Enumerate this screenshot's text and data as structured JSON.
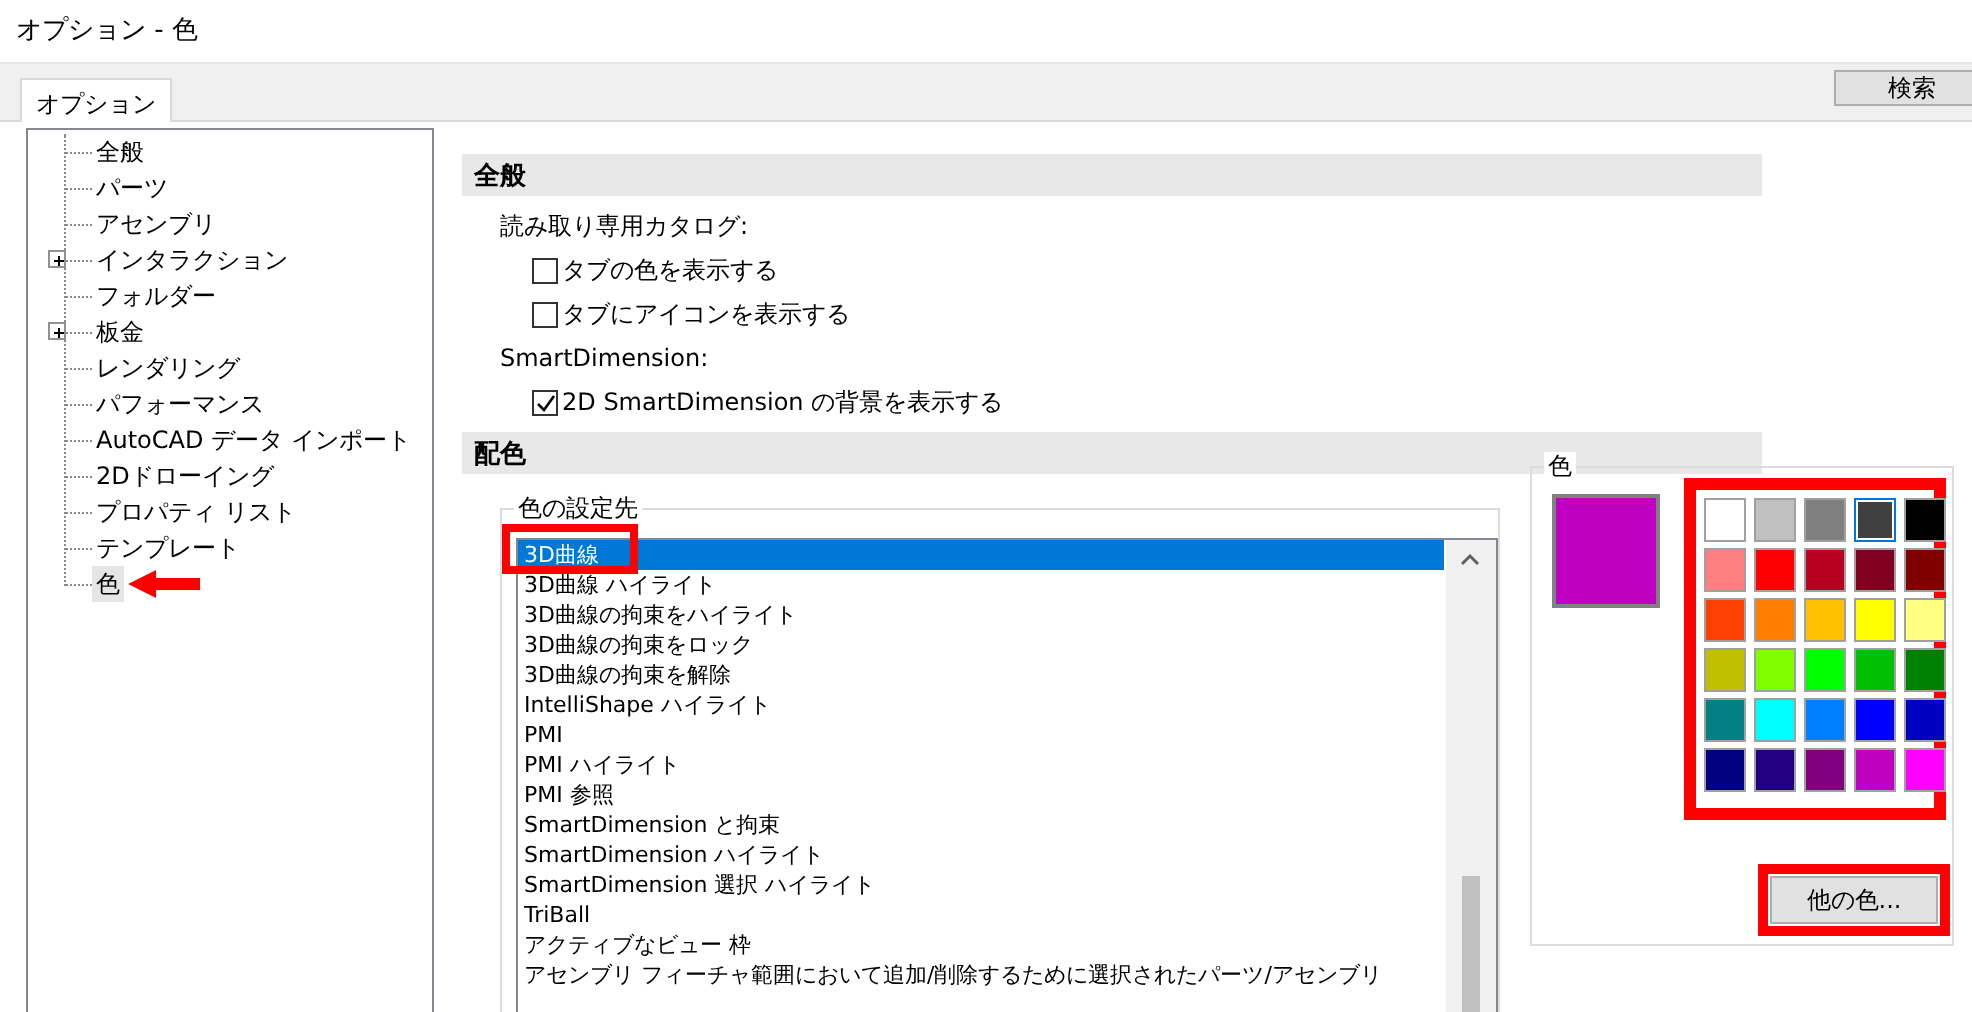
{
  "window": {
    "title": "オプション - 色"
  },
  "tabs": [
    {
      "label": "オプション",
      "selected": true
    }
  ],
  "search_button": {
    "label": "検索"
  },
  "sidebar": {
    "items": [
      {
        "label": "全般",
        "expandable": false,
        "selected": false,
        "arrow": false
      },
      {
        "label": "パーツ",
        "expandable": false,
        "selected": false,
        "arrow": false
      },
      {
        "label": "アセンブリ",
        "expandable": false,
        "selected": false,
        "arrow": false
      },
      {
        "label": "インタラクション",
        "expandable": true,
        "selected": false,
        "arrow": false
      },
      {
        "label": "フォルダー",
        "expandable": false,
        "selected": false,
        "arrow": false
      },
      {
        "label": "板金",
        "expandable": true,
        "selected": false,
        "arrow": false
      },
      {
        "label": "レンダリング",
        "expandable": false,
        "selected": false,
        "arrow": false
      },
      {
        "label": "パフォーマンス",
        "expandable": false,
        "selected": false,
        "arrow": false
      },
      {
        "label": "AutoCAD データ インポート",
        "expandable": false,
        "selected": false,
        "arrow": false
      },
      {
        "label": "2Dドローイング",
        "expandable": false,
        "selected": false,
        "arrow": false
      },
      {
        "label": "プロパティ リスト",
        "expandable": false,
        "selected": false,
        "arrow": false
      },
      {
        "label": "テンプレート",
        "expandable": false,
        "selected": false,
        "arrow": false
      },
      {
        "label": "色",
        "expandable": false,
        "selected": true,
        "arrow": true
      }
    ]
  },
  "general": {
    "title": "全般",
    "groups": [
      {
        "label": "読み取り専用カタログ:",
        "options": [
          {
            "label": "タブの色を表示する",
            "checked": false
          },
          {
            "label": "タブにアイコンを表示する",
            "checked": false
          }
        ]
      },
      {
        "label": "SmartDimension:",
        "options": [
          {
            "label": "2D SmartDimension の背景を表示する",
            "checked": true
          }
        ]
      }
    ]
  },
  "coloring": {
    "title": "配色",
    "target": {
      "legend": "色の設定先",
      "items": [
        {
          "label": "3D曲線",
          "selected": true,
          "highlighted": true
        },
        {
          "label": "3D曲線 ハイライト",
          "selected": false,
          "highlighted": false
        },
        {
          "label": "3D曲線の拘束をハイライト",
          "selected": false,
          "highlighted": false
        },
        {
          "label": "3D曲線の拘束をロック",
          "selected": false,
          "highlighted": false
        },
        {
          "label": "3D曲線の拘束を解除",
          "selected": false,
          "highlighted": false
        },
        {
          "label": "IntelliShape ハイライト",
          "selected": false,
          "highlighted": false
        },
        {
          "label": "PMI",
          "selected": false,
          "highlighted": false
        },
        {
          "label": "PMI ハイライト",
          "selected": false,
          "highlighted": false
        },
        {
          "label": "PMI 参照",
          "selected": false,
          "highlighted": false
        },
        {
          "label": "SmartDimension と拘束",
          "selected": false,
          "highlighted": false
        },
        {
          "label": "SmartDimension ハイライト",
          "selected": false,
          "highlighted": false
        },
        {
          "label": "SmartDimension 選択 ハイライト",
          "selected": false,
          "highlighted": false
        },
        {
          "label": "TriBall",
          "selected": false,
          "highlighted": false
        },
        {
          "label": "アクティブなビュー 枠",
          "selected": false,
          "highlighted": false
        },
        {
          "label": "アセンブリ フィーチャ範囲において追加/削除するために選択されたパーツ/アセンブリ",
          "selected": false,
          "highlighted": false
        }
      ]
    },
    "color": {
      "legend": "色",
      "preview": {
        "color": "#c000c0"
      },
      "palette_highlighted": true,
      "swatches": [
        {
          "color": "#ffffff",
          "selected": false
        },
        {
          "color": "#c0c0c0",
          "selected": false
        },
        {
          "color": "#808080",
          "selected": false
        },
        {
          "color": "#404040",
          "selected": true
        },
        {
          "color": "#000000",
          "selected": false
        },
        {
          "color": "#ff8080",
          "selected": false
        },
        {
          "color": "#ff0000",
          "selected": false
        },
        {
          "color": "#b80020",
          "selected": false
        },
        {
          "color": "#800020",
          "selected": false
        },
        {
          "color": "#800000",
          "selected": false
        },
        {
          "color": "#ff4000",
          "selected": false
        },
        {
          "color": "#ff8000",
          "selected": false
        },
        {
          "color": "#ffc000",
          "selected": false
        },
        {
          "color": "#ffff00",
          "selected": false
        },
        {
          "color": "#ffff80",
          "selected": false
        },
        {
          "color": "#c0c000",
          "selected": false
        },
        {
          "color": "#80ff00",
          "selected": false
        },
        {
          "color": "#00ff00",
          "selected": false
        },
        {
          "color": "#00c000",
          "selected": false
        },
        {
          "color": "#008000",
          "selected": false
        },
        {
          "color": "#008080",
          "selected": false
        },
        {
          "color": "#00ffff",
          "selected": false
        },
        {
          "color": "#0080ff",
          "selected": false
        },
        {
          "color": "#0000ff",
          "selected": false
        },
        {
          "color": "#0000c0",
          "selected": false
        },
        {
          "color": "#000080",
          "selected": false
        },
        {
          "color": "#200080",
          "selected": false
        },
        {
          "color": "#800080",
          "selected": false
        },
        {
          "color": "#c000c0",
          "selected": false
        },
        {
          "color": "#ff00ff",
          "selected": false
        }
      ],
      "more_button": {
        "label": "他の色...",
        "highlighted": true
      }
    }
  }
}
